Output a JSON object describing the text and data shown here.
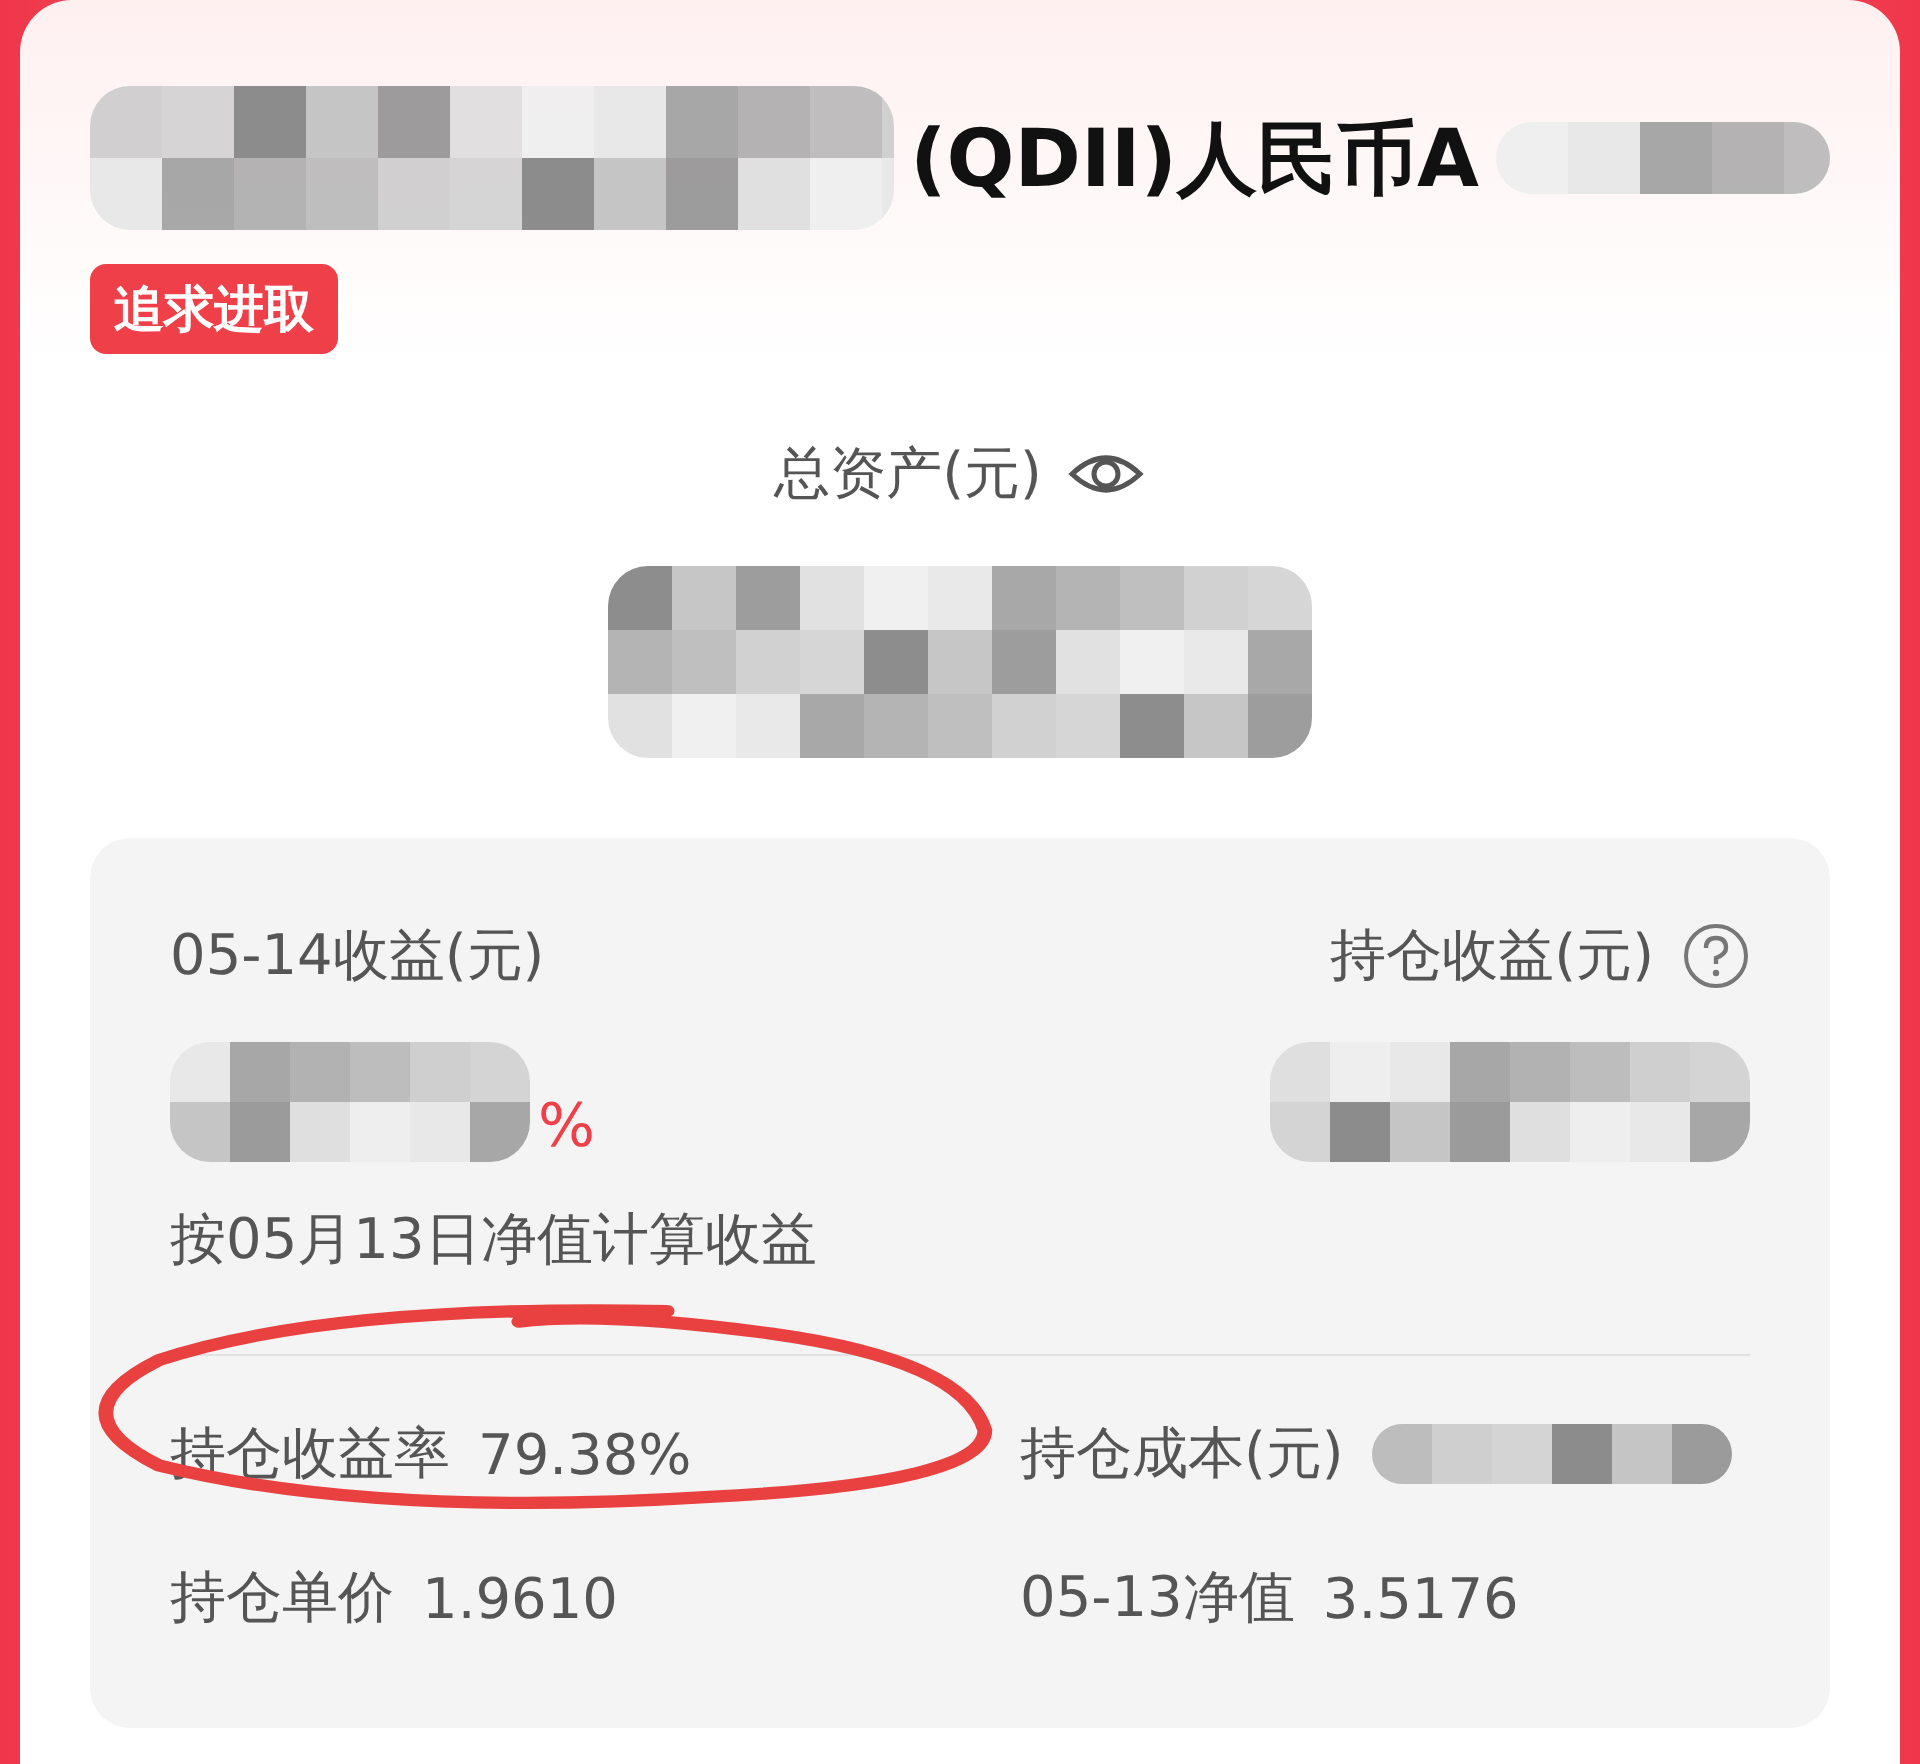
{
  "fund": {
    "title": "(QDII)人民币A",
    "tag": "追求进取"
  },
  "total_assets": {
    "label": "总资产(元)"
  },
  "daily": {
    "label": "05-14收益(元)",
    "percent_tail": "%",
    "note": "按05月13日净值计算收益"
  },
  "holding": {
    "label": "持仓收益(元)"
  },
  "stats": [
    {
      "label": "持仓收益率",
      "value": "79.38%"
    },
    {
      "label": "持仓成本(元)"
    },
    {
      "label": "持仓单价",
      "value": "1.9610"
    },
    {
      "label": "05-13净值",
      "value": "3.5176"
    }
  ]
}
